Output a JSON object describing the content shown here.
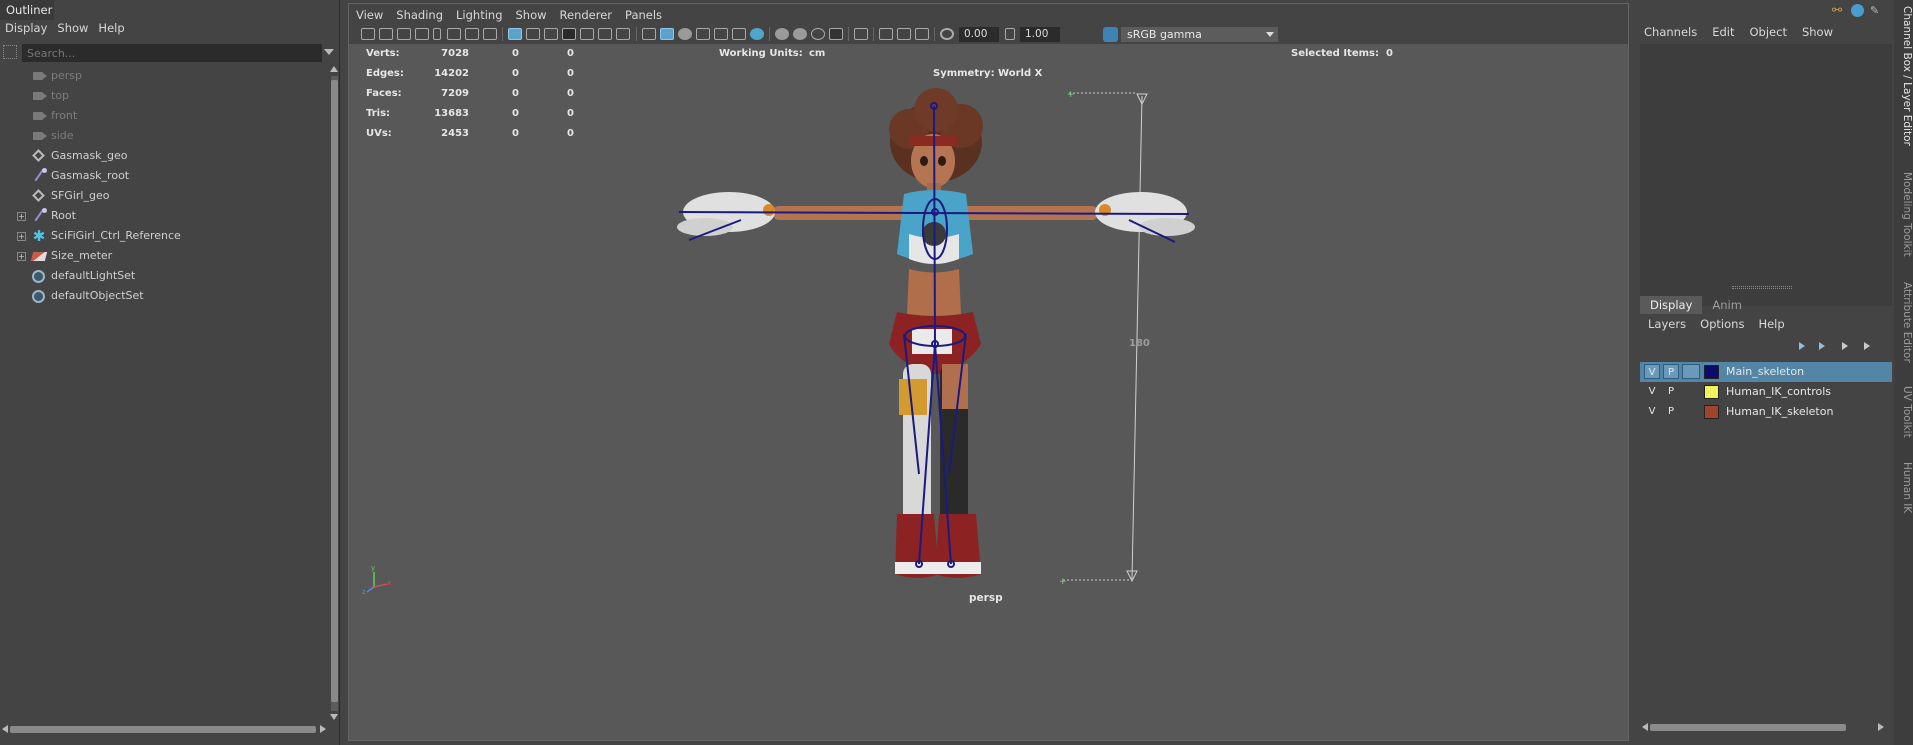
{
  "outliner": {
    "title": "Outliner",
    "menu": [
      "Display",
      "Show",
      "Help"
    ],
    "search_placeholder": "Search...",
    "items": [
      {
        "label": "persp",
        "icon": "camera-icon",
        "dim": true,
        "expandable": false
      },
      {
        "label": "top",
        "icon": "camera-icon",
        "dim": true,
        "expandable": false
      },
      {
        "label": "front",
        "icon": "camera-icon",
        "dim": true,
        "expandable": false
      },
      {
        "label": "side",
        "icon": "camera-icon",
        "dim": true,
        "expandable": false
      },
      {
        "label": "Gasmask_geo",
        "icon": "mesh-icon",
        "dim": false,
        "expandable": false
      },
      {
        "label": "Gasmask_root",
        "icon": "joint-icon",
        "dim": false,
        "expandable": false
      },
      {
        "label": "SFGirl_geo",
        "icon": "mesh-icon",
        "dim": false,
        "expandable": false
      },
      {
        "label": "Root",
        "icon": "joint-icon",
        "dim": false,
        "expandable": true
      },
      {
        "label": "SciFiGirl_Ctrl_Reference",
        "icon": "reference-icon",
        "dim": false,
        "expandable": true
      },
      {
        "label": "Size_meter",
        "icon": "ruler-icon",
        "dim": false,
        "expandable": true
      },
      {
        "label": "defaultLightSet",
        "icon": "set-icon",
        "dim": false,
        "expandable": false
      },
      {
        "label": "defaultObjectSet",
        "icon": "set-icon",
        "dim": false,
        "expandable": false
      }
    ]
  },
  "viewport": {
    "menu": [
      "View",
      "Shading",
      "Lighting",
      "Show",
      "Renderer",
      "Panels"
    ],
    "exposure": "0.00",
    "gamma": "1.00",
    "color_space": "sRGB gamma",
    "hud": {
      "stats": [
        {
          "label": "Verts:",
          "v1": "7028",
          "v2": "0",
          "v3": "0"
        },
        {
          "label": "Edges:",
          "v1": "14202",
          "v2": "0",
          "v3": "0"
        },
        {
          "label": "Faces:",
          "v1": "7209",
          "v2": "0",
          "v3": "0"
        },
        {
          "label": "Tris:",
          "v1": "13683",
          "v2": "0",
          "v3": "0"
        },
        {
          "label": "UVs:",
          "v1": "2453",
          "v2": "0",
          "v3": "0"
        }
      ],
      "working_units_label": "Working Units:",
      "working_units_value": "cm",
      "symmetry": "Symmetry: World X",
      "selected_items_label": "Selected Items:",
      "selected_items_value": "0"
    },
    "measure_value": "180",
    "camera_label": "persp",
    "axis_labels": {
      "y": "y",
      "x": "x",
      "z": "z"
    }
  },
  "channel_box": {
    "menu": [
      "Channels",
      "Edit",
      "Object",
      "Show"
    ]
  },
  "layer_editor": {
    "tabs": [
      "Display",
      "Anim"
    ],
    "active_tab": "Display",
    "menu": [
      "Layers",
      "Options",
      "Help"
    ],
    "layers": [
      {
        "v": "V",
        "p": "P",
        "name": "Main_skeleton",
        "color": "#0c0c6e",
        "selected": true
      },
      {
        "v": "V",
        "p": "P",
        "name": "Human_IK_controls",
        "color": "#f2f25a",
        "selected": false
      },
      {
        "v": "V",
        "p": "P",
        "name": "Human_IK_skeleton",
        "color": "#a0442f",
        "selected": false
      }
    ]
  },
  "side_tabs": [
    "Channel Box / Layer Editor",
    "Modeling Toolkit",
    "Attribute Editor",
    "UV Toolkit",
    "Human IK"
  ],
  "colors": {
    "selection": "#5285a6",
    "accent_blue": "#5ea2cc",
    "panel": "#444444",
    "viewport_bg": "#585858"
  }
}
